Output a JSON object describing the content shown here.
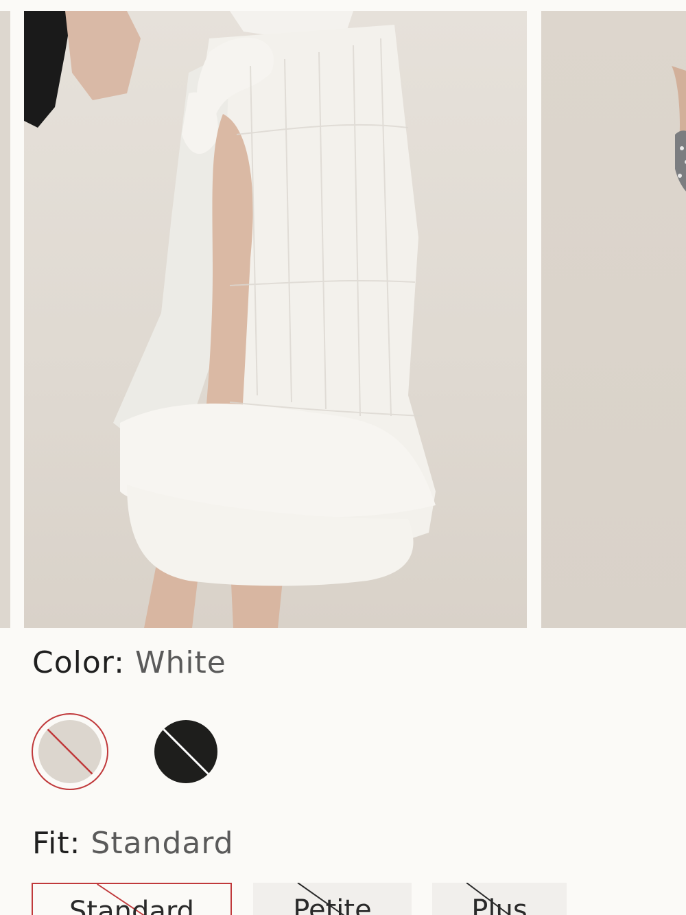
{
  "product": {
    "color_label": "Color:",
    "color_value": "White",
    "fit_label": "Fit:",
    "fit_value": "Standard"
  },
  "swatches": [
    {
      "name": "White",
      "hex": "#dcd6ce",
      "selected": true,
      "unavailable": true
    },
    {
      "name": "Black",
      "hex": "#1e1e1c",
      "selected": false,
      "unavailable": true
    }
  ],
  "fits": [
    {
      "label": "Standard",
      "selected": true,
      "unavailable": true
    },
    {
      "label": "Petite",
      "selected": false,
      "unavailable": true
    },
    {
      "label": "Plus",
      "selected": false,
      "unavailable": true
    }
  ],
  "colors": {
    "accent": "#c0393b",
    "background": "#fbfaf7"
  }
}
